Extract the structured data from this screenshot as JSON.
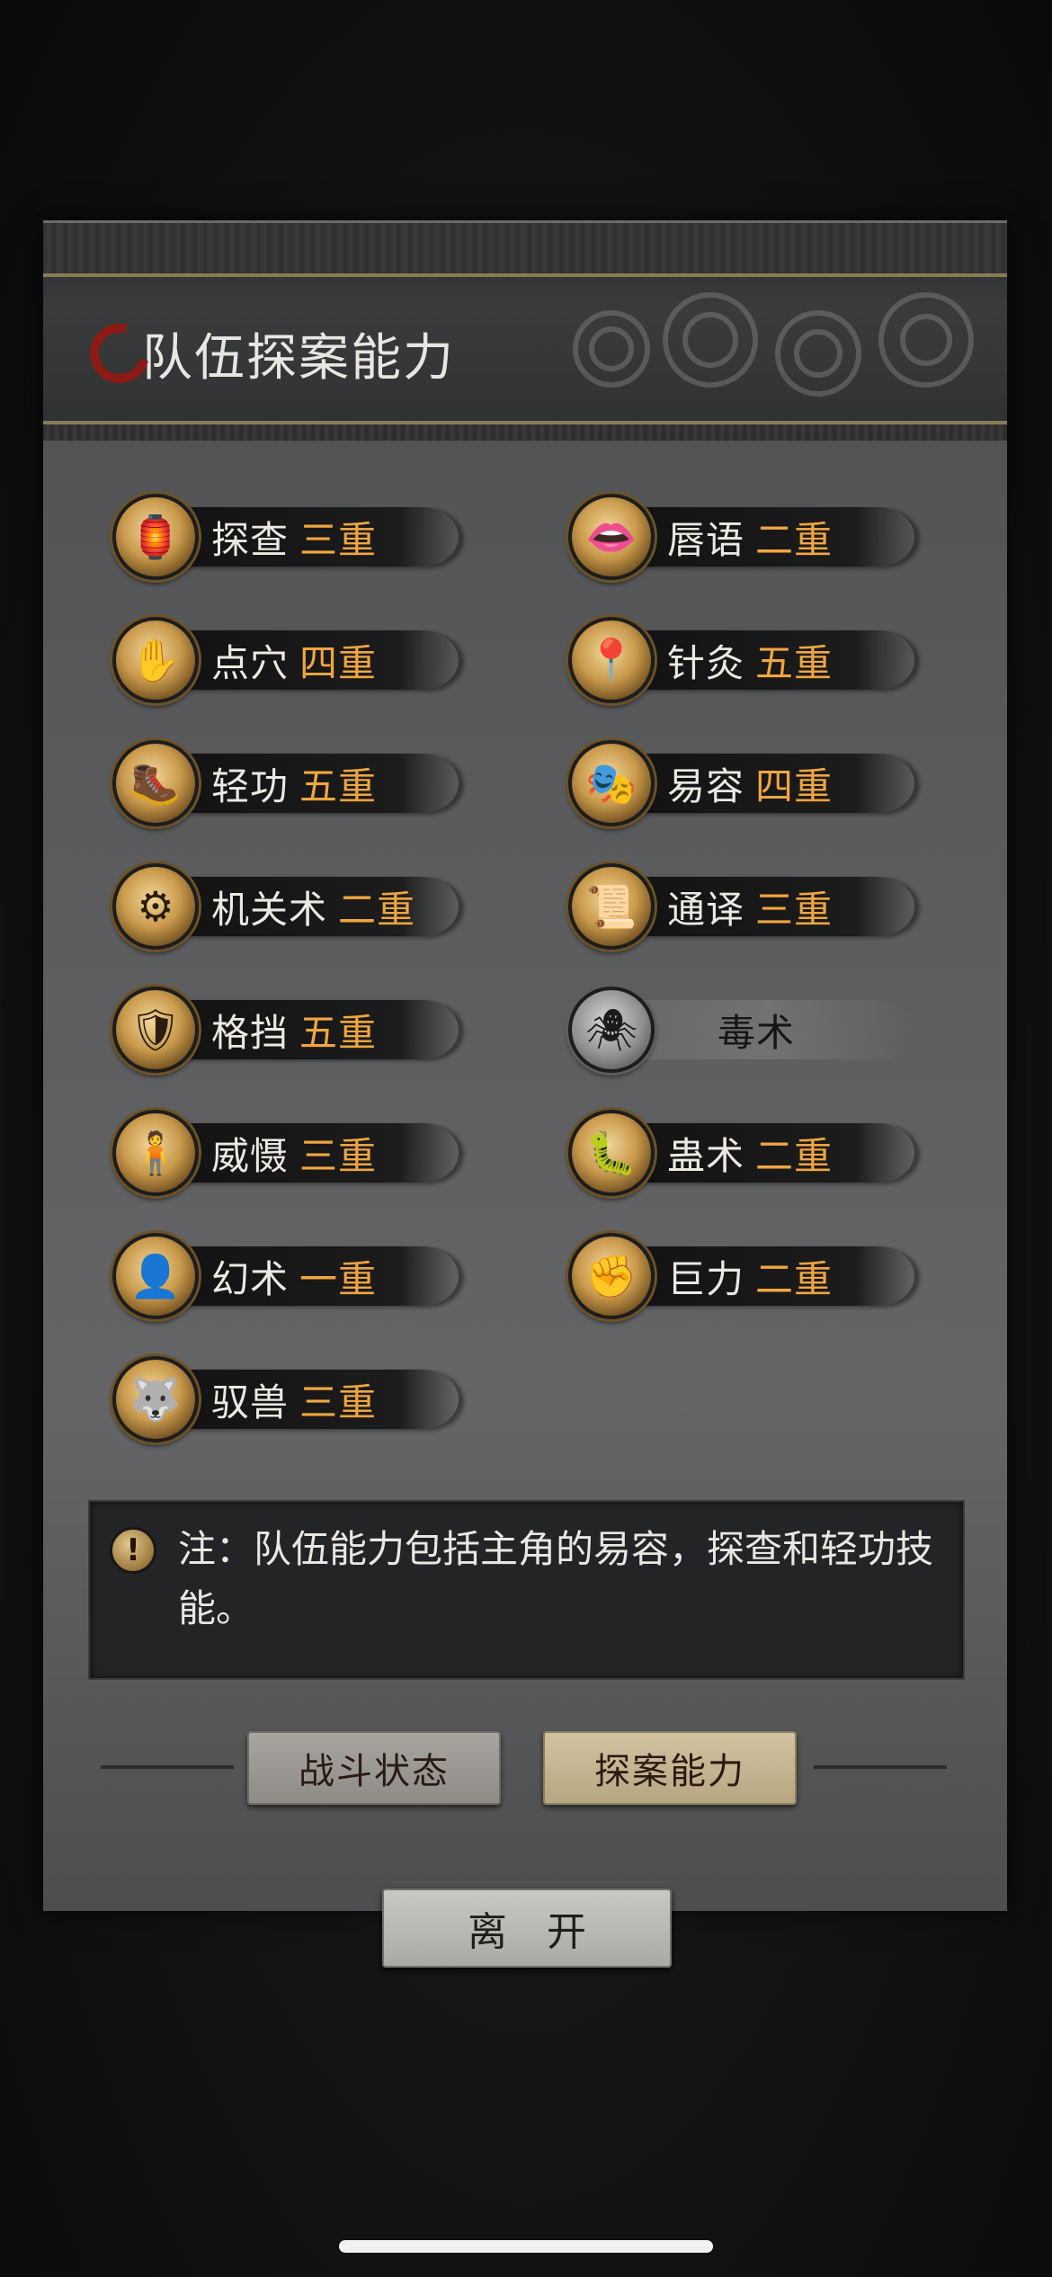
{
  "header": {
    "title": "队伍探案能力"
  },
  "skills": [
    {
      "name": "探查",
      "level": "三重",
      "icon": "investigate-icon",
      "glyph": "🏮"
    },
    {
      "name": "唇语",
      "level": "二重",
      "icon": "lip-reading-icon",
      "glyph": "👄"
    },
    {
      "name": "点穴",
      "level": "四重",
      "icon": "acupoint-icon",
      "glyph": "✋"
    },
    {
      "name": "针灸",
      "level": "五重",
      "icon": "acupuncture-icon",
      "glyph": "📍"
    },
    {
      "name": "轻功",
      "level": "五重",
      "icon": "lightness-skill-icon",
      "glyph": "🥾"
    },
    {
      "name": "易容",
      "level": "四重",
      "icon": "disguise-icon",
      "glyph": "🎭"
    },
    {
      "name": "机关术",
      "level": "二重",
      "icon": "mechanism-icon",
      "glyph": "⚙"
    },
    {
      "name": "通译",
      "level": "三重",
      "icon": "translation-icon",
      "glyph": "📜"
    },
    {
      "name": "格挡",
      "level": "五重",
      "icon": "block-icon",
      "glyph": "🛡"
    },
    {
      "name": "毒术",
      "level": "",
      "icon": "poison-spider-icon",
      "glyph": "🕷",
      "locked": true
    },
    {
      "name": "威慑",
      "level": "三重",
      "icon": "intimidate-icon",
      "glyph": "🧍"
    },
    {
      "name": "蛊术",
      "level": "二重",
      "icon": "gu-worm-icon",
      "glyph": "🐛"
    },
    {
      "name": "幻术",
      "level": "一重",
      "icon": "illusion-icon",
      "glyph": "👤"
    },
    {
      "name": "巨力",
      "level": "二重",
      "icon": "strength-icon",
      "glyph": "✊"
    },
    {
      "name": "驭兽",
      "level": "三重",
      "icon": "beast-taming-icon",
      "glyph": "🐺"
    }
  ],
  "note": {
    "text": "注：队伍能力包括主角的易容，探查和轻功技能。"
  },
  "tabs": {
    "battle": "战斗状态",
    "explore": "探案能力"
  },
  "leave_button": "离　开",
  "colors": {
    "level": "#f0a640",
    "accent_red": "#8b1b14"
  }
}
